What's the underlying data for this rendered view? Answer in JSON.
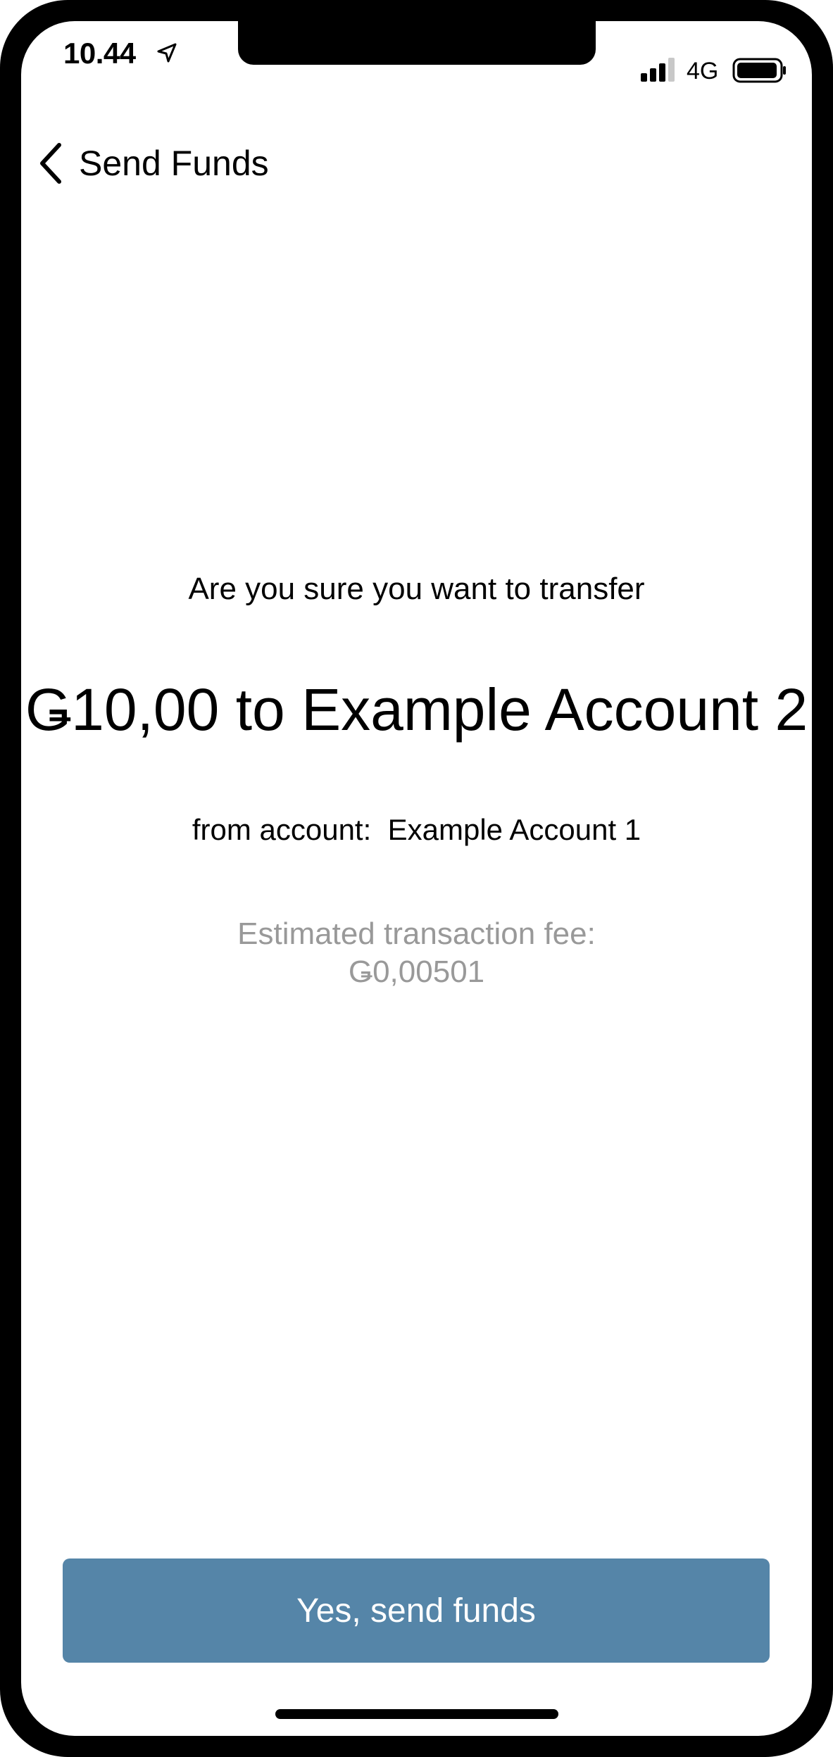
{
  "status_bar": {
    "time": "10.44",
    "network": "4G",
    "icons": [
      "location-arrow-icon",
      "signal-bars-icon",
      "battery-icon"
    ]
  },
  "nav": {
    "title": "Send Funds",
    "back_icon": "chevron-left-icon"
  },
  "confirmation": {
    "prompt": "Are you sure you want to transfer",
    "amount_line": "Ǥ10,00 to Example Account 2",
    "from_line": "from account:  Example Account 1",
    "fee_label": "Estimated transaction fee:",
    "fee_value": "Ǥ0,00501"
  },
  "actions": {
    "send_label": "Yes, send funds"
  },
  "colors": {
    "primary_button": "#5585a8",
    "muted_text": "#999999",
    "text": "#000000",
    "background": "#ffffff"
  }
}
